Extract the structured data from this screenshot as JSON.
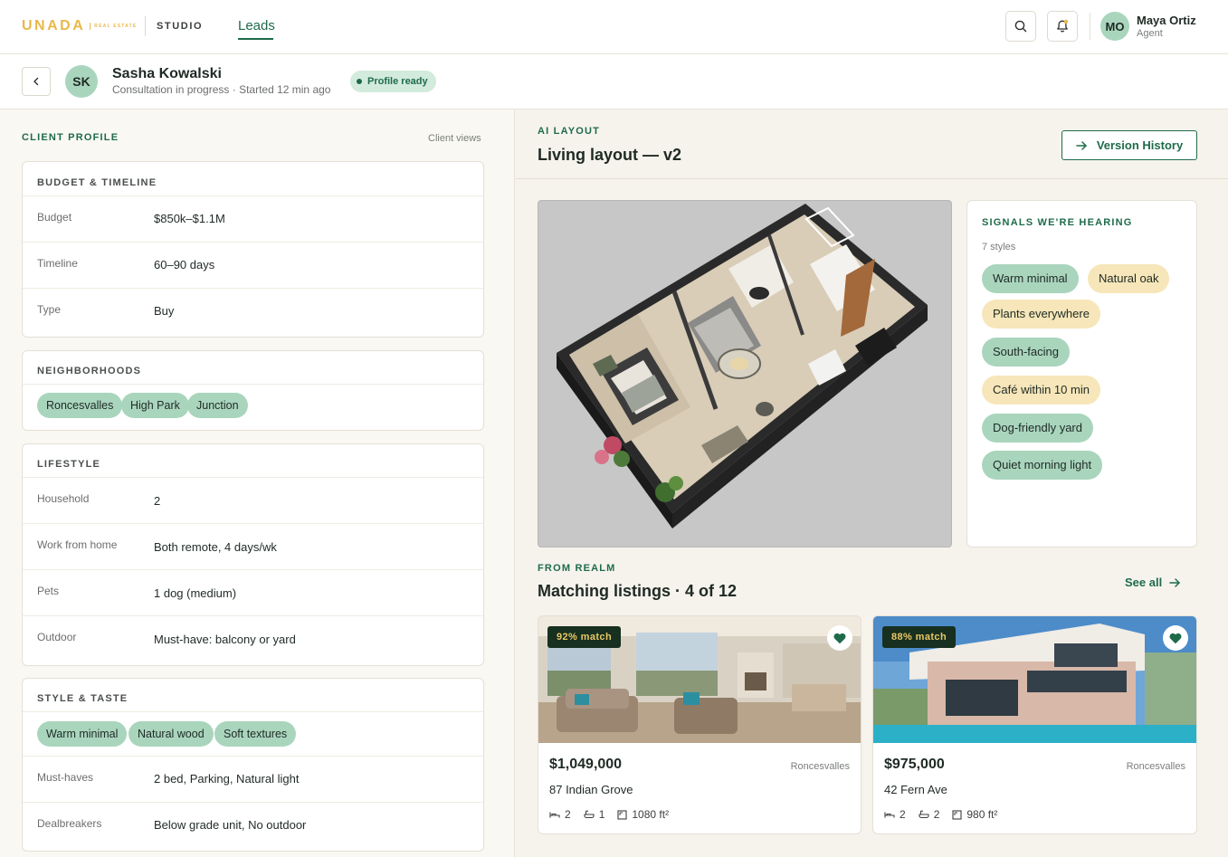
{
  "brand": {
    "logo": "UNADA",
    "logo_sub": "REAL ESTATE",
    "studio": "STUDIO"
  },
  "nav": {
    "active": "Leads"
  },
  "user": {
    "initials": "MO",
    "name": "Maya Ortiz",
    "role": "Agent"
  },
  "client": {
    "initials": "SK",
    "name": "Sasha Kowalski",
    "status": "Consultation in progress · Started 12 min ago",
    "badge": "Profile ready"
  },
  "profile": {
    "section_label": "CLIENT PROFILE",
    "client_views": "Client views",
    "budget": {
      "title": "BUDGET & TIMELINE",
      "rows": [
        {
          "label": "Budget",
          "value": "$850k–$1.1M"
        },
        {
          "label": "Timeline",
          "value": "60–90 days"
        },
        {
          "label": "Type",
          "value": "Buy"
        }
      ]
    },
    "neighborhoods": {
      "title": "NEIGHBORHOODS",
      "chips": [
        "Roncesvalles",
        "High Park",
        "Junction"
      ]
    },
    "lifestyle": {
      "title": "LIFESTYLE",
      "rows": [
        {
          "label": "Household",
          "value": "2"
        },
        {
          "label": "Work from home",
          "value": "Both remote, 4 days/wk"
        },
        {
          "label": "Pets",
          "value": "1 dog (medium)"
        },
        {
          "label": "Outdoor",
          "value": "Must-have: balcony or yard"
        }
      ]
    },
    "style": {
      "title": "STYLE & TASTE",
      "chips": [
        "Warm minimal",
        "Natural wood",
        "Soft textures"
      ],
      "rows": [
        {
          "label": "Must-haves",
          "value": "2 bed, Parking, Natural light"
        },
        {
          "label": "Dealbreakers",
          "value": "Below grade unit, No outdoor"
        }
      ]
    }
  },
  "layout": {
    "section_label": "AI LAYOUT",
    "title": "Living layout — v2",
    "version_history": "Version History"
  },
  "signals": {
    "title": "SIGNALS WE'RE HEARING",
    "count": "7 styles",
    "chips": [
      {
        "label": "Warm minimal",
        "tone": "green"
      },
      {
        "label": "Natural oak",
        "tone": "yellow"
      },
      {
        "label": "Plants everywhere",
        "tone": "yellow"
      },
      {
        "label": "South-facing",
        "tone": "green"
      },
      {
        "label": "Café within 10 min",
        "tone": "yellow"
      },
      {
        "label": "Dog-friendly yard",
        "tone": "green"
      },
      {
        "label": "Quiet morning light",
        "tone": "green"
      }
    ]
  },
  "listings": {
    "section_label": "FROM REALM",
    "title": "Matching listings · 4 of 12",
    "see_all": "See all",
    "items": [
      {
        "match": "92% match",
        "price": "$1,049,000",
        "neighborhood": "Roncesvalles",
        "address": "87 Indian Grove",
        "beds": "2",
        "baths": "1",
        "area": "1080 ft²"
      },
      {
        "match": "88% match",
        "price": "$975,000",
        "neighborhood": "Roncesvalles",
        "address": "42 Fern Ave",
        "beds": "2",
        "baths": "2",
        "area": "980 ft²"
      }
    ]
  },
  "colors": {
    "accent": "#1e6b4a",
    "chip_green": "#a9d5bd",
    "chip_yellow": "#f6e6b9",
    "brand_gold": "#e9b84a"
  }
}
